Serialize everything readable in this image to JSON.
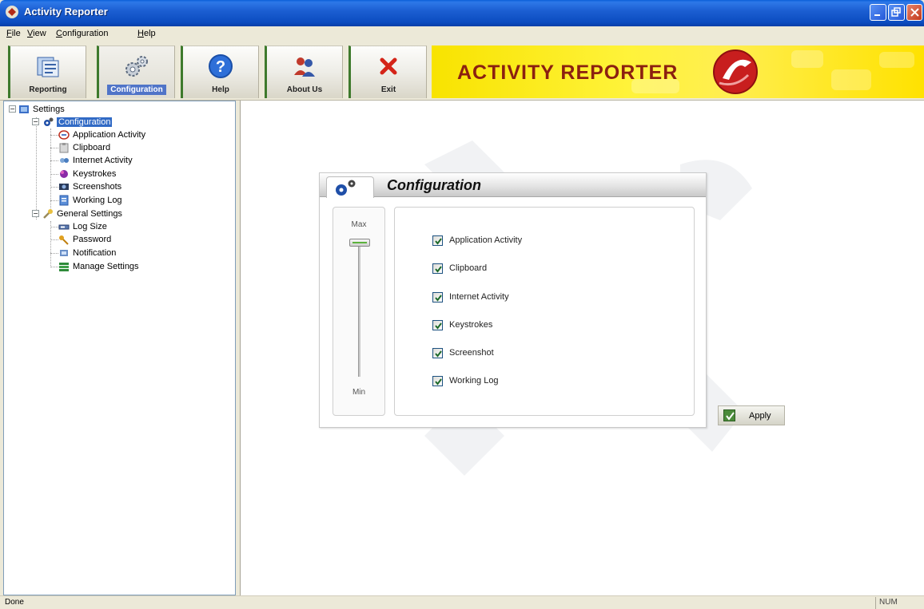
{
  "window": {
    "title": "Activity Reporter"
  },
  "menu": [
    {
      "hotkey": "F",
      "rest": "ile"
    },
    {
      "hotkey": "V",
      "rest": "iew"
    },
    {
      "hotkey": "C",
      "rest": "onfiguration"
    },
    {
      "hotkey": "H",
      "rest": "elp"
    }
  ],
  "toolbar": {
    "reporting": "Reporting",
    "configuration": "Configuration",
    "help": "Help",
    "about": "About Us",
    "exit": "Exit",
    "banner": "ACTIVITY REPORTER"
  },
  "tree": {
    "root": "Settings",
    "configuration": "Configuration",
    "config_items": [
      "Application Activity",
      "Clipboard",
      "Internet Activity",
      "Keystrokes",
      "Screenshots",
      "Working Log"
    ],
    "general": "General Settings",
    "general_items": [
      "Log Size",
      "Password",
      "Notification",
      "Manage Settings"
    ]
  },
  "panel": {
    "title": "Configuration",
    "slider_max": "Max",
    "slider_min": "Min",
    "options": [
      "Application Activity",
      "Clipboard",
      "Internet Activity",
      "Keystrokes",
      "Screenshot",
      "Working Log"
    ],
    "apply": "Apply"
  },
  "status": {
    "text": "Done",
    "num": "NUM"
  },
  "colors": {
    "titlebar": "#0B4CC0",
    "banner": "#FFEE00",
    "selection": "#316AC5",
    "accent_green": "#3E7A2C"
  }
}
